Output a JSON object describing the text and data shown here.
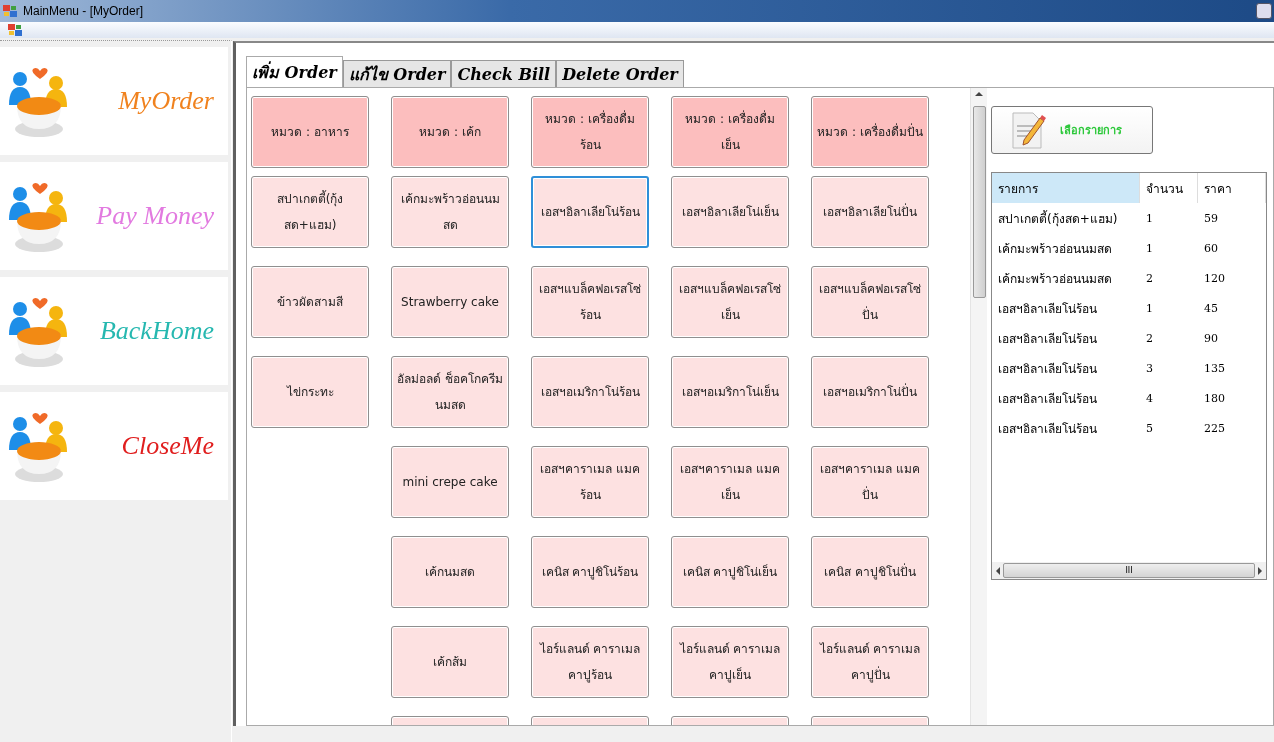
{
  "window": {
    "title": "MainMenu - [MyOrder]"
  },
  "nav": [
    {
      "label": "MyOrder",
      "color": "#f0821e"
    },
    {
      "label": "Pay Money",
      "color": "#e27ae0"
    },
    {
      "label": "BackHome",
      "color": "#26b8b0"
    },
    {
      "label": "CloseMe",
      "color": "#e01e1e"
    }
  ],
  "tabs": [
    {
      "label": "เพิ่ม Order",
      "selected": true
    },
    {
      "label": "แก้ไข Order",
      "selected": false
    },
    {
      "label": "Check Bill",
      "selected": false
    },
    {
      "label": "Delete Order",
      "selected": false
    }
  ],
  "menu_rows": [
    {
      "cells": [
        {
          "kind": "category",
          "label": "หมวด : อาหาร",
          "focused": false
        },
        {
          "kind": "category",
          "label": "หมวด : เค้ก",
          "focused": false
        },
        {
          "kind": "category",
          "label": "หมวด : เครื่องดื่มร้อน",
          "focused": false
        },
        {
          "kind": "category",
          "label": "หมวด : เครื่องดื่มเย็น",
          "focused": false
        },
        {
          "kind": "category",
          "label": "หมวด : เครื่องดื่มปั่น",
          "focused": false
        }
      ]
    },
    {
      "cells": [
        {
          "kind": "item",
          "label": "สปาเกตตี้(กุ้งสด+แฮม)",
          "focused": false
        },
        {
          "kind": "item",
          "label": "เค้กมะพร้าวอ่อนนมสด",
          "focused": false
        },
        {
          "kind": "item",
          "label": "เอสฯอิลาเลียโน่ร้อน",
          "focused": true
        },
        {
          "kind": "item",
          "label": "เอสฯอิลาเลียโน่เย็น",
          "focused": false
        },
        {
          "kind": "item",
          "label": "เอสฯอิลาเลียโน่ปั่น",
          "focused": false
        }
      ]
    },
    {
      "cells": [
        {
          "kind": "item",
          "label": "ข้าวผัดสามสี",
          "focused": false
        },
        {
          "kind": "item",
          "label": "Strawberry cake",
          "focused": false
        },
        {
          "kind": "item",
          "label": "เอสฯแบล็คฟอเรสโซ่ร้อน",
          "focused": false
        },
        {
          "kind": "item",
          "label": "เอสฯแบล็คฟอเรสโซ่เย็น",
          "focused": false
        },
        {
          "kind": "item",
          "label": "เอสฯแบล็คฟอเรสโซ่ปั่น",
          "focused": false
        }
      ]
    },
    {
      "cells": [
        {
          "kind": "item",
          "label": "ไข่กระทะ",
          "focused": false
        },
        {
          "kind": "item",
          "label": "อัลม่อลด์ ช็อคโกครีมนมสด",
          "focused": false
        },
        {
          "kind": "item",
          "label": "เอสฯอเมริกาโน่ร้อน",
          "focused": false
        },
        {
          "kind": "item",
          "label": "เอสฯอเมริกาโน่เย็น",
          "focused": false
        },
        {
          "kind": "item",
          "label": "เอสฯอเมริกาโน่ปั่น",
          "focused": false
        }
      ]
    },
    {
      "cells": [
        {
          "kind": "empty"
        },
        {
          "kind": "item",
          "label": "mini crepe cake",
          "focused": false
        },
        {
          "kind": "item",
          "label": "เอสฯคาราเมล แมคร้อน",
          "focused": false
        },
        {
          "kind": "item",
          "label": "เอสฯคาราเมล แมคเย็น",
          "focused": false
        },
        {
          "kind": "item",
          "label": "เอสฯคาราเมล แมคปั่น",
          "focused": false
        }
      ]
    },
    {
      "cells": [
        {
          "kind": "empty"
        },
        {
          "kind": "item",
          "label": "เค้กนมสด",
          "focused": false
        },
        {
          "kind": "item",
          "label": "เคนิส คาปูชิโน่ร้อน",
          "focused": false
        },
        {
          "kind": "item",
          "label": "เคนิส คาปูชิโน่เย็น",
          "focused": false
        },
        {
          "kind": "item",
          "label": "เคนิส คาปูชิโน่ปั่น",
          "focused": false
        }
      ]
    },
    {
      "cells": [
        {
          "kind": "empty"
        },
        {
          "kind": "item",
          "label": "เค้กส้ม",
          "focused": false
        },
        {
          "kind": "item",
          "label": "ไอร์แลนด์ คาราเมลคาปูร้อน",
          "focused": false
        },
        {
          "kind": "item",
          "label": "ไอร์แลนด์ คาราเมลคาปูเย็น",
          "focused": false
        },
        {
          "kind": "item",
          "label": "ไอร์แลนด์ คาราเมลคาปูปั่น",
          "focused": false
        }
      ]
    },
    {
      "cells": [
        {
          "kind": "empty"
        },
        {
          "kind": "cut",
          "focused": false
        },
        {
          "kind": "cut",
          "focused": false
        },
        {
          "kind": "cut",
          "focused": false
        },
        {
          "kind": "cut",
          "focused": false
        }
      ]
    }
  ],
  "select_button": {
    "label": "เลือกรายการ"
  },
  "order_list": {
    "columns": [
      "รายการ",
      "จำนวน",
      "ราคา"
    ],
    "rows": [
      [
        "สปาเกตตี้(กุ้งสด+แฮม)",
        "1",
        "59"
      ],
      [
        "เค้กมะพร้าวอ่อนนมสด",
        "1",
        "60"
      ],
      [
        "เค้กมะพร้าวอ่อนนมสด",
        "2",
        "120"
      ],
      [
        "เอสฯอิลาเลียโน่ร้อน",
        "1",
        "45"
      ],
      [
        "เอสฯอิลาเลียโน่ร้อน",
        "2",
        "90"
      ],
      [
        "เอสฯอิลาเลียโน่ร้อน",
        "3",
        "135"
      ],
      [
        "เอสฯอิลาเลียโน่ร้อน",
        "4",
        "180"
      ],
      [
        "เอสฯอิลาเลียโน่ร้อน",
        "5",
        "225"
      ]
    ],
    "hscroll": {
      "label": "III"
    }
  }
}
